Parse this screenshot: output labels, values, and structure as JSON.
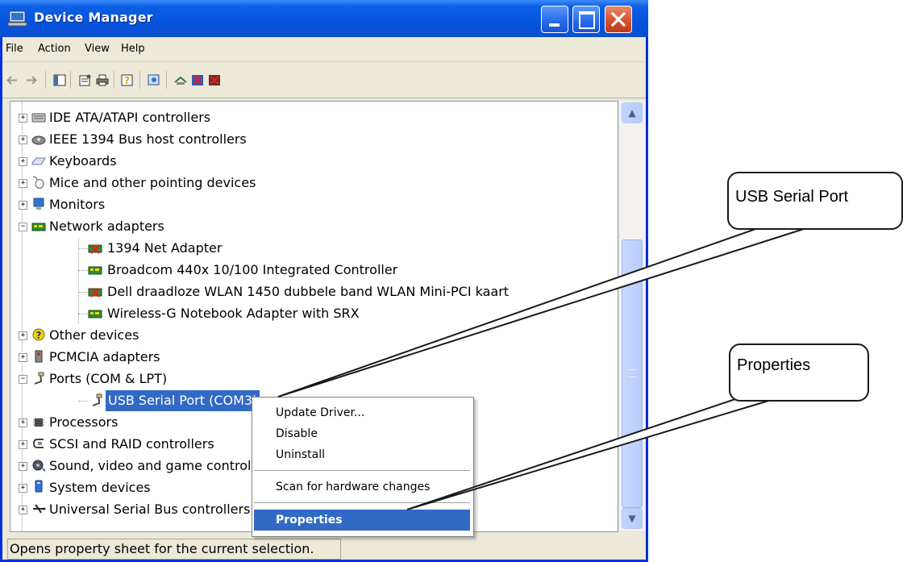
{
  "window": {
    "title": "Device Manager"
  },
  "menu": [
    "File",
    "Action",
    "View",
    "Help"
  ],
  "toolbar_icons": [
    "back-arrow-icon",
    "forward-arrow-icon",
    "console-tree-icon",
    "properties-icon",
    "print-icon",
    "help-icon",
    "scan-hardware-icon",
    "update-driver-icon",
    "disable-device-icon",
    "uninstall-device-icon"
  ],
  "tree": [
    {
      "label": "IDE ATA/ATAPI controllers",
      "expander": "+",
      "icon": "ide-controller-icon"
    },
    {
      "label": "IEEE 1394 Bus host controllers",
      "expander": "+",
      "icon": "firewire-controller-icon"
    },
    {
      "label": "Keyboards",
      "expander": "+",
      "icon": "keyboard-icon"
    },
    {
      "label": "Mice and other pointing devices",
      "expander": "+",
      "icon": "mouse-icon"
    },
    {
      "label": "Monitors",
      "expander": "+",
      "icon": "monitor-icon"
    },
    {
      "label": "Network adapters",
      "expander": "-",
      "icon": "network-adapter-icon"
    },
    {
      "label": "1394 Net Adapter",
      "icon": "network-adapter-disabled-icon"
    },
    {
      "label": "Broadcom 440x 10/100 Integrated Controller",
      "icon": "network-adapter-icon"
    },
    {
      "label": "Dell draadloze WLAN 1450 dubbele band WLAN Mini-PCI kaart",
      "icon": "network-adapter-disabled-icon"
    },
    {
      "label": "Wireless-G Notebook Adapter with SRX",
      "icon": "network-adapter-icon"
    },
    {
      "label": "Other devices",
      "expander": "+",
      "icon": "unknown-device-icon"
    },
    {
      "label": "PCMCIA adapters",
      "expander": "+",
      "icon": "pcmcia-icon"
    },
    {
      "label": "Ports (COM & LPT)",
      "expander": "-",
      "icon": "port-icon"
    },
    {
      "label": "USB Serial Port (COM3)",
      "icon": "port-icon",
      "selected": true
    },
    {
      "label": "Processors",
      "expander": "+",
      "icon": "processor-icon"
    },
    {
      "label": "SCSI and RAID controllers",
      "expander": "+",
      "icon": "scsi-controller-icon"
    },
    {
      "label": "Sound, video and game controllers",
      "expander": "+",
      "icon": "sound-icon"
    },
    {
      "label": "System devices",
      "expander": "+",
      "icon": "system-device-icon"
    },
    {
      "label": "Universal Serial Bus controllers",
      "expander": "+",
      "icon": "usb-icon"
    }
  ],
  "context_menu": {
    "items": [
      "Update Driver...",
      "Disable",
      "Uninstall",
      "Scan for hardware changes",
      "Properties"
    ],
    "active": "Properties"
  },
  "status": {
    "text": "Opens property sheet for the current selection."
  },
  "callouts": {
    "usb": "USB Serial Port",
    "properties": "Properties"
  },
  "colors": {
    "selection": "#316ac5",
    "titlebar": "#0553dd",
    "window_bg": "#ece9d8"
  }
}
